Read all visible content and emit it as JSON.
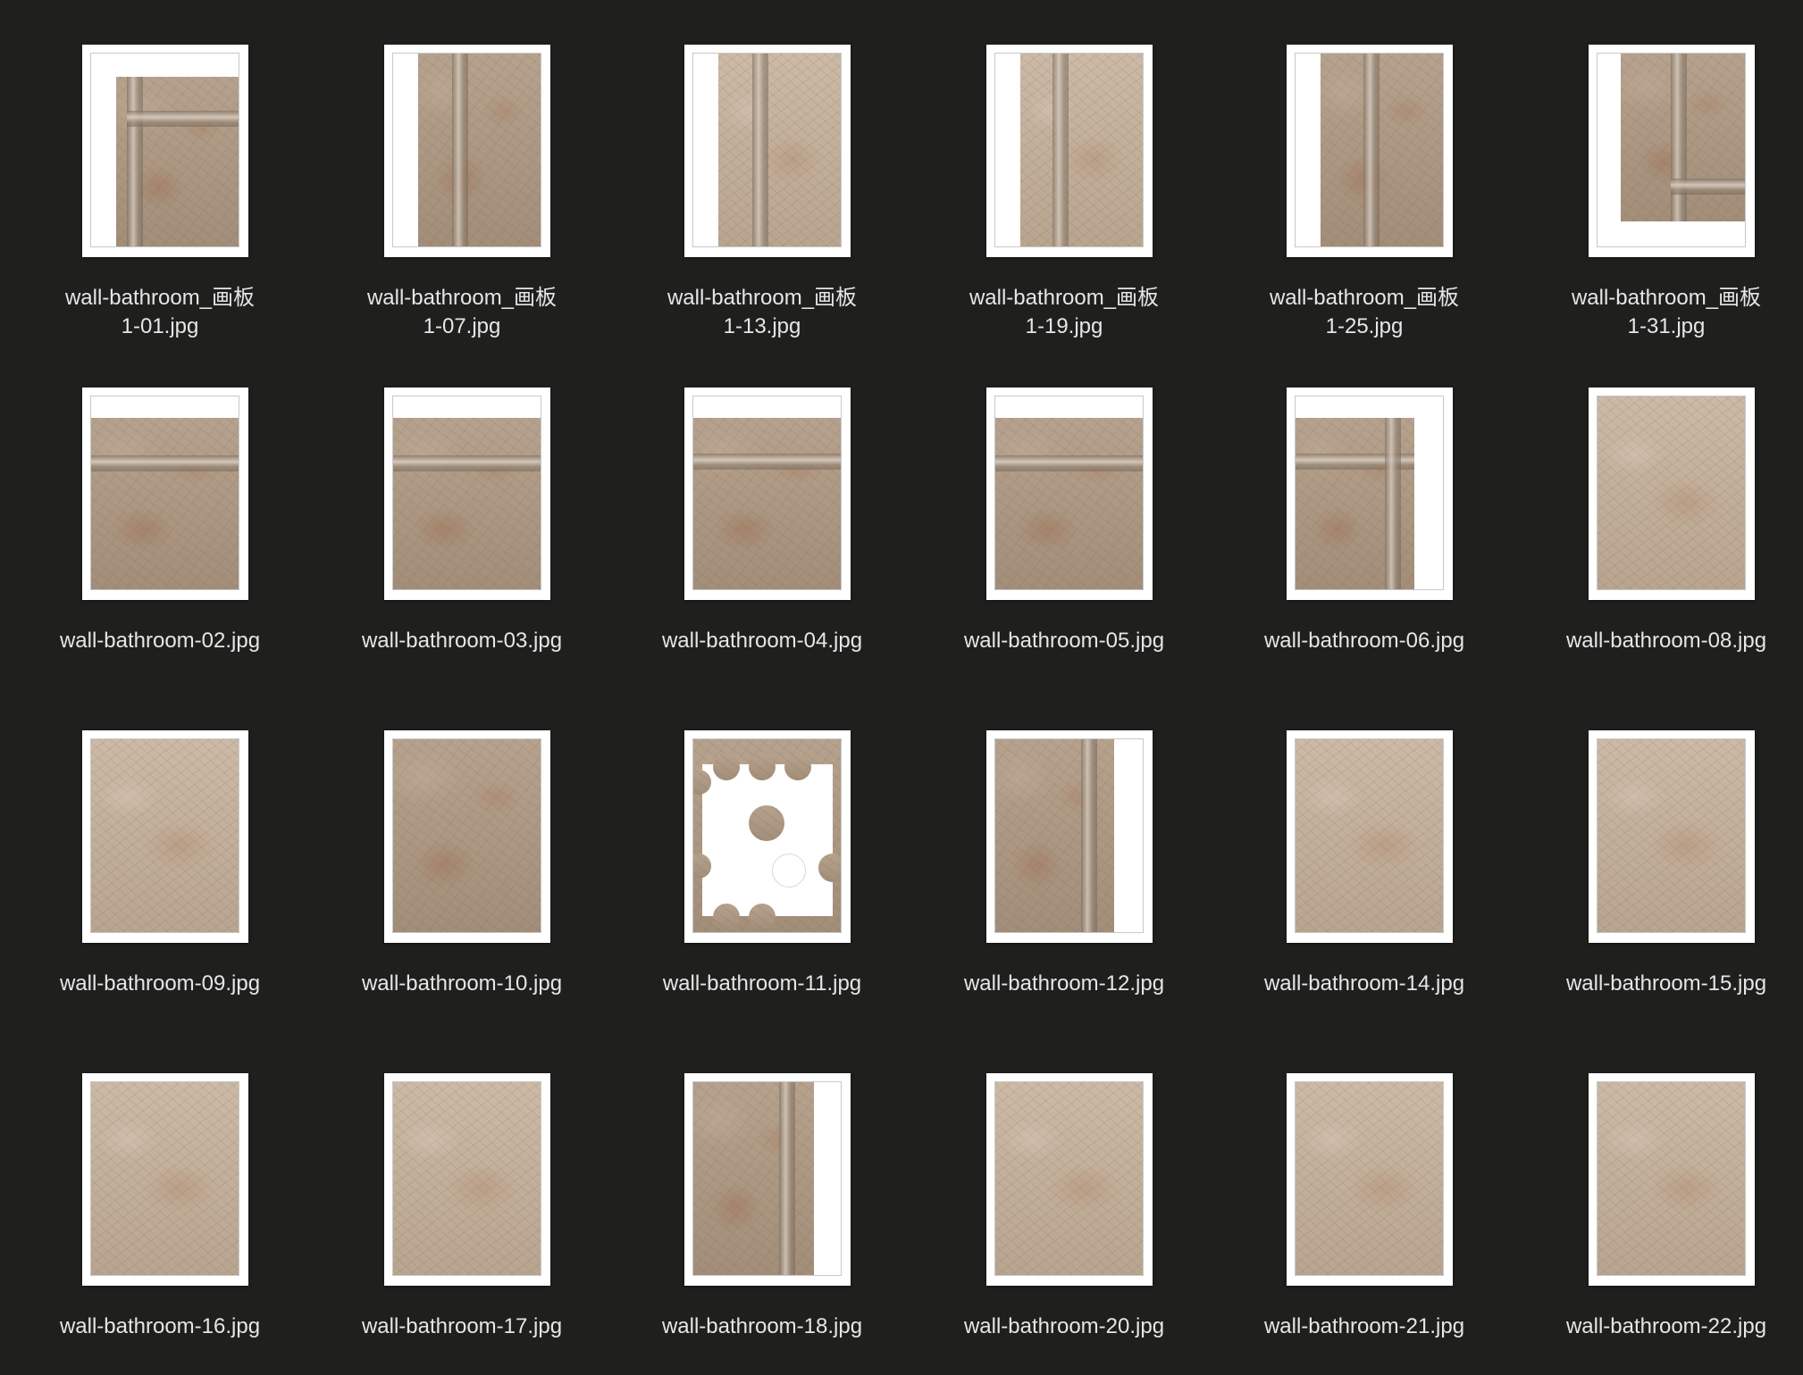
{
  "view": {
    "background": "#1f1f1e",
    "label_color": "#e6e6e6"
  },
  "files": [
    {
      "name": "wall-bathroom_画板\n1-01.jpg"
    },
    {
      "name": "wall-bathroom_画板\n1-07.jpg"
    },
    {
      "name": "wall-bathroom_画板\n1-13.jpg"
    },
    {
      "name": "wall-bathroom_画板\n1-19.jpg"
    },
    {
      "name": "wall-bathroom_画板\n1-25.jpg"
    },
    {
      "name": "wall-bathroom_画板\n1-31.jpg"
    },
    {
      "name": "wall-bathroom-02.jpg"
    },
    {
      "name": "wall-bathroom-03.jpg"
    },
    {
      "name": "wall-bathroom-04.jpg"
    },
    {
      "name": "wall-bathroom-05.jpg"
    },
    {
      "name": "wall-bathroom-06.jpg"
    },
    {
      "name": "wall-bathroom-08.jpg"
    },
    {
      "name": "wall-bathroom-09.jpg"
    },
    {
      "name": "wall-bathroom-10.jpg"
    },
    {
      "name": "wall-bathroom-11.jpg"
    },
    {
      "name": "wall-bathroom-12.jpg"
    },
    {
      "name": "wall-bathroom-14.jpg"
    },
    {
      "name": "wall-bathroom-15.jpg"
    },
    {
      "name": "wall-bathroom-16.jpg"
    },
    {
      "name": "wall-bathroom-17.jpg"
    },
    {
      "name": "wall-bathroom-18.jpg"
    },
    {
      "name": "wall-bathroom-20.jpg"
    },
    {
      "name": "wall-bathroom-21.jpg"
    },
    {
      "name": "wall-bathroom-22.jpg"
    }
  ]
}
